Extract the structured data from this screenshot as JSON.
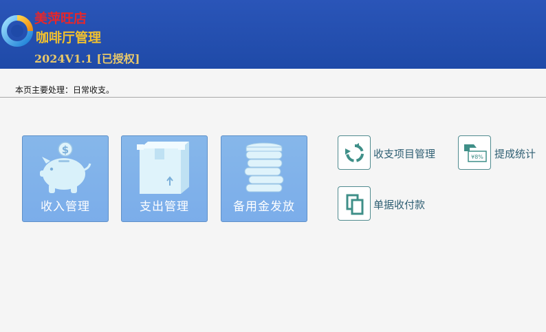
{
  "header": {
    "shop_name": "美萍旺店",
    "app_name": "咖啡厅管理",
    "version": "2024V1.1 [已授权]",
    "logo_icon": "logo-ring-icon"
  },
  "notice": {
    "text": "本页主要处理：日常收支。"
  },
  "main_buttons": [
    {
      "label": "收入管理",
      "icon": "piggy-bank-icon"
    },
    {
      "label": "支出管理",
      "icon": "box-icon"
    },
    {
      "label": "备用金发放",
      "icon": "coin-stack-icon"
    }
  ],
  "shortcuts": [
    {
      "label": "收支项目管理",
      "icon": "refresh-icon"
    },
    {
      "label": "提成统计",
      "icon": "commission-icon",
      "icon_text": "¥8%"
    },
    {
      "label": "单据收付款",
      "icon": "copy-icon"
    }
  ],
  "colors": {
    "header_bg": "#2a55b8",
    "shop_name": "#e8262a",
    "app_name": "#f2c12e",
    "tile_bg": "#86b7ea",
    "shortcut_text": "#2f5f73",
    "shortcut_icon": "#3f8f88"
  }
}
